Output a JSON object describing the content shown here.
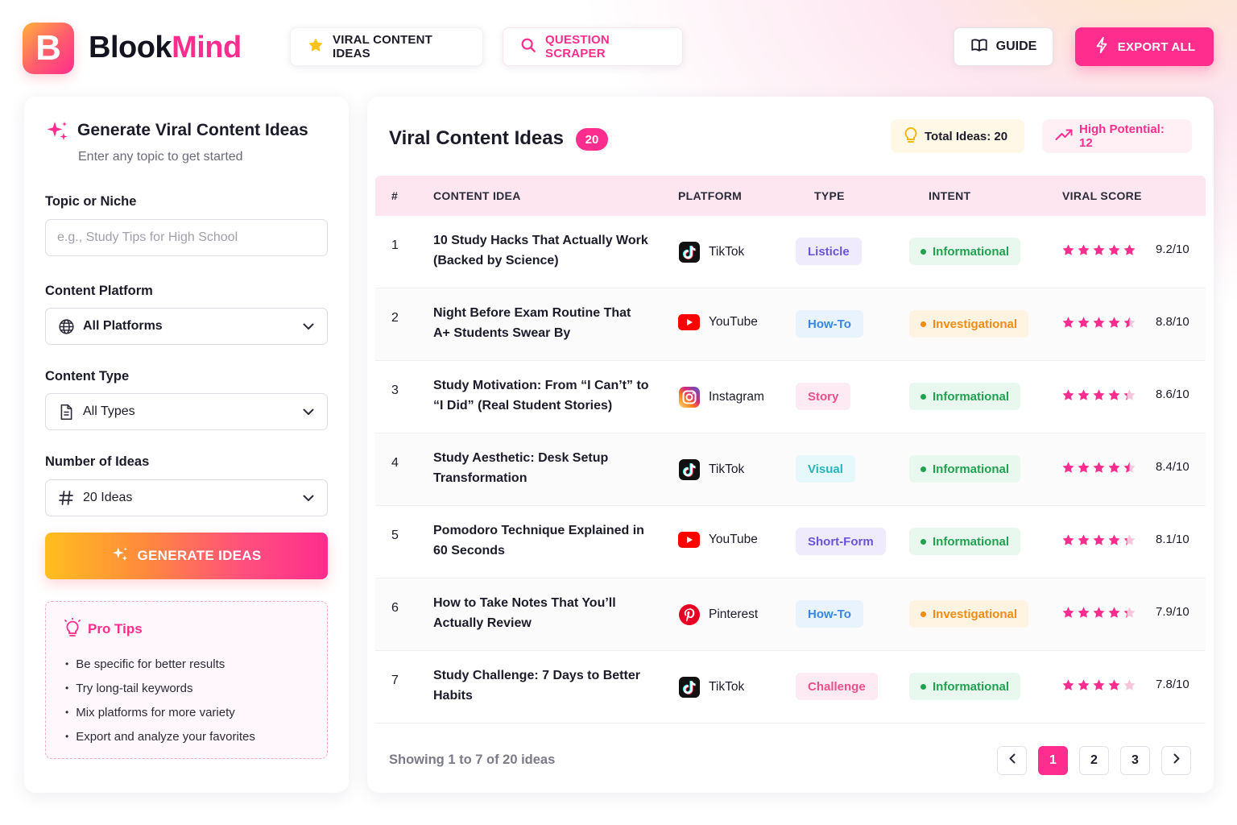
{
  "brand": {
    "logo_letter": "B",
    "name_part1": "Blook",
    "name_part2": "Mind"
  },
  "nav": {
    "viral_label": "VIRAL CONTENT IDEAS",
    "scraper_label": "QUESTION SCRAPER",
    "guide_label": "GUIDE",
    "export_label": "EXPORT ALL"
  },
  "form": {
    "title": "Generate Viral Content Ideas",
    "subtitle": "Enter any topic to get started",
    "topic_label": "Topic or Niche",
    "topic_placeholder": "e.g., Study Tips for High School",
    "topic_value": "",
    "platform_label": "Content Platform",
    "platform_value": "All Platforms",
    "type_label": "Content Type",
    "type_value": "All Types",
    "count_label": "Number of Ideas",
    "count_value": "20 Ideas",
    "generate_label": "GENERATE IDEAS"
  },
  "tips": {
    "title": "Pro Tips",
    "items": [
      "Be specific for better results",
      "Try long-tail keywords",
      "Mix platforms for more variety",
      "Export and analyze your favorites"
    ]
  },
  "results": {
    "title": "Viral Content Ideas",
    "count_badge": "20",
    "total_label": "Total Ideas: 20",
    "high_label": "High Potential: 12",
    "columns": [
      "#",
      "CONTENT IDEA",
      "PLATFORM",
      "TYPE",
      "INTENT",
      "VIRAL SCORE"
    ],
    "rows": [
      {
        "num": "1",
        "idea": "10 Study Hacks That Actually Work (Backed by Science)",
        "platform": "TikTok",
        "platform_icon": "tiktok-icon",
        "type": "Listicle",
        "intent": "Informational",
        "stars": 5,
        "score": "9.2/10"
      },
      {
        "num": "2",
        "idea": "Night Before Exam Routine That A+ Students Swear By",
        "platform": "YouTube",
        "platform_icon": "youtube-icon",
        "type": "How-To",
        "intent": "Investigational",
        "stars": 4.5,
        "score": "8.8/10"
      },
      {
        "num": "3",
        "idea": "Study Motivation: From “I Can’t” to “I Did” (Real Student Stories)",
        "platform": "Instagram",
        "platform_icon": "instagram-icon",
        "type": "Story",
        "intent": "Informational",
        "stars": 4.3,
        "score": "8.6/10"
      },
      {
        "num": "4",
        "idea": "Study Aesthetic: Desk Setup Transformation",
        "platform": "TikTok",
        "platform_icon": "tiktok-icon",
        "type": "Visual",
        "intent": "Informational",
        "stars": 4.5,
        "score": "8.4/10"
      },
      {
        "num": "5",
        "idea": "Pomodoro Technique Explained in 60 Seconds",
        "platform": "YouTube",
        "platform_icon": "youtube-icon",
        "type": "Short-Form",
        "intent": "Informational",
        "stars": 4.3,
        "score": "8.1/10"
      },
      {
        "num": "6",
        "idea": "How to Take Notes That You’ll Actually Review",
        "platform": "Pinterest",
        "platform_icon": "pinterest-icon",
        "type": "How-To",
        "intent": "Investigational",
        "stars": 4.3,
        "score": "7.9/10"
      },
      {
        "num": "7",
        "idea": "Study Challenge: 7 Days to Better Habits",
        "platform": "TikTok",
        "platform_icon": "tiktok-icon",
        "type": "Challenge",
        "intent": "Informational",
        "stars": 4,
        "score": "7.8/10"
      }
    ],
    "footer_text": "Showing 1 to 7 of 20 ideas",
    "pages": [
      "1",
      "2",
      "3"
    ],
    "current_page": "1"
  },
  "colors": {
    "accent": "#ff2d8e",
    "star": "#ff2d8e",
    "star_empty": "#f6c6da",
    "type_badges": {
      "Listicle": {
        "bg": "#efebfd",
        "fg": "#6a55d8"
      },
      "How-To": {
        "bg": "#e8f3fe",
        "fg": "#3a86e0"
      },
      "Story": {
        "bg": "#fdeaf2",
        "fg": "#e9508e"
      },
      "Visual": {
        "bg": "#e6f8f9",
        "fg": "#27b3bf"
      },
      "Short-Form": {
        "bg": "#efebfd",
        "fg": "#6a55d8"
      },
      "Challenge": {
        "bg": "#fdeaf2",
        "fg": "#e9508e"
      }
    },
    "intent_badges": {
      "Informational": {
        "bg": "#e9f8ee",
        "fg": "#22a150",
        "dot": "#22a150"
      },
      "Investigational": {
        "bg": "#fff3e2",
        "fg": "#f08c17",
        "dot": "#f08c17"
      }
    }
  }
}
